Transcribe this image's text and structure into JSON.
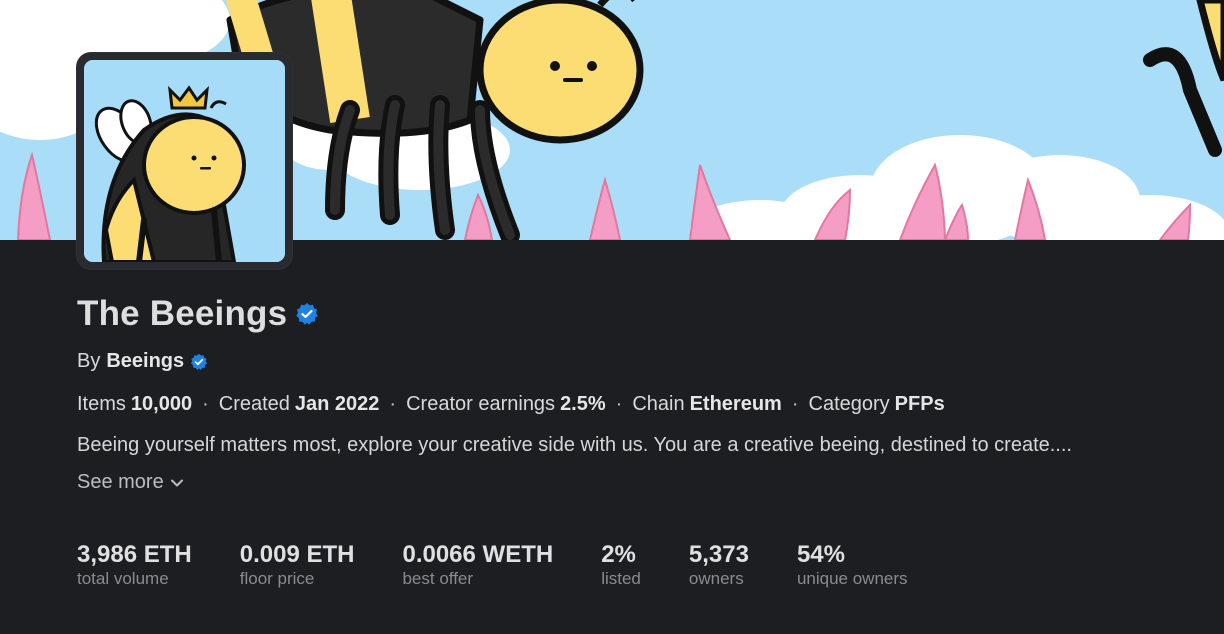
{
  "collection": {
    "name": "The Beeings",
    "creator_prefix": "By",
    "creator": "Beeings",
    "meta": [
      {
        "label": "Items",
        "value": "10,000"
      },
      {
        "label": "Created",
        "value": "Jan 2022"
      },
      {
        "label": "Creator earnings",
        "value": "2.5%"
      },
      {
        "label": "Chain",
        "value": "Ethereum"
      },
      {
        "label": "Category",
        "value": "PFPs"
      }
    ],
    "separator": "·",
    "description": "Beeing yourself matters most, explore your creative side with us. You are a creative beeing, destined to create....",
    "see_more": "See more"
  },
  "stats": [
    {
      "value": "3,986 ETH",
      "label": "total volume"
    },
    {
      "value": "0.009 ETH",
      "label": "floor price"
    },
    {
      "value": "0.0066 WETH",
      "label": "best offer"
    },
    {
      "value": "2%",
      "label": "listed"
    },
    {
      "value": "5,373",
      "label": "owners"
    },
    {
      "value": "54%",
      "label": "unique owners"
    }
  ],
  "colors": {
    "background": "#1d1e22",
    "verified_badge": "#2081e2",
    "sky": "#a6dcf7",
    "bee_yellow": "#fcdd73",
    "bee_black": "#262626"
  }
}
